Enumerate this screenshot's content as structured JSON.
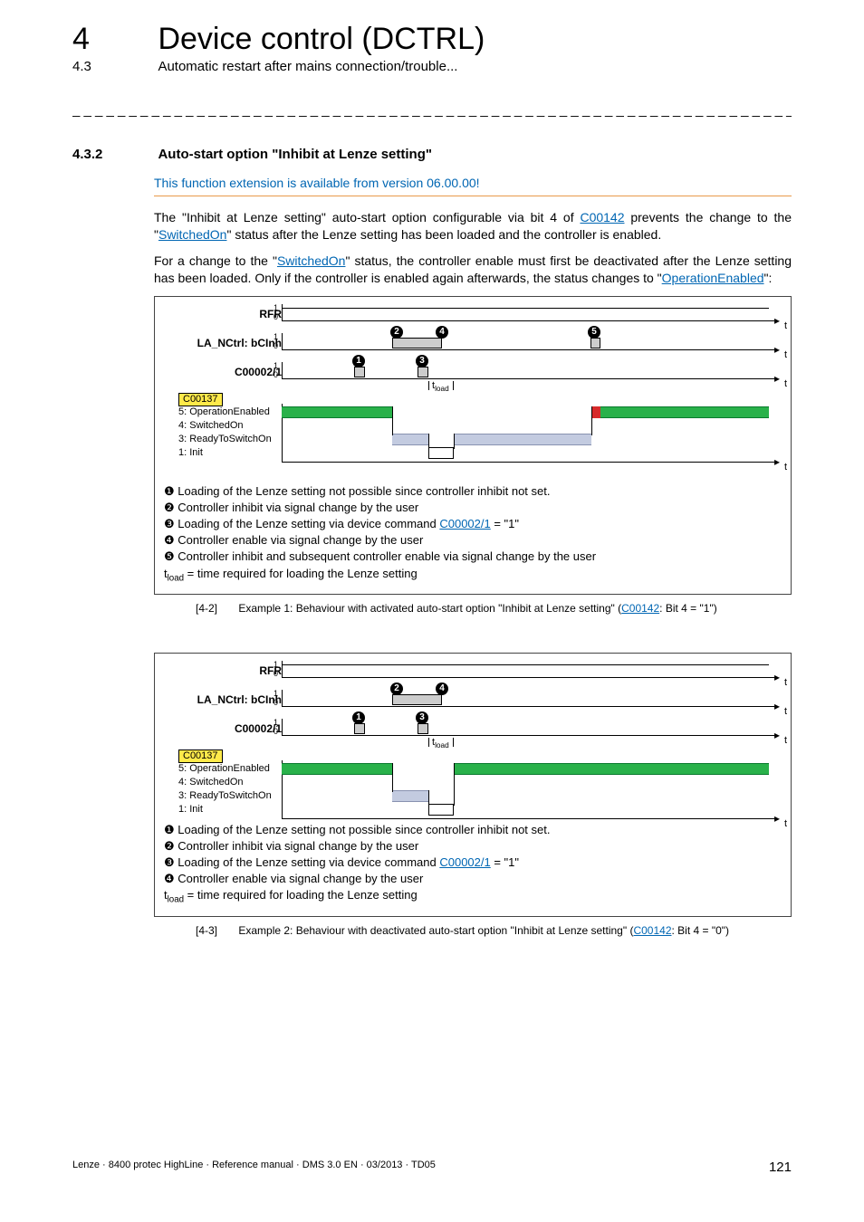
{
  "header": {
    "chapter_num": "4",
    "chapter_title": "Device control (DCTRL)",
    "sub_num": "4.3",
    "sub_title": "Automatic restart after mains connection/trouble...",
    "dash_rule": "_ _ _ _ _ _ _ _ _ _ _ _ _ _ _ _ _ _ _ _ _ _ _ _ _ _ _ _ _ _ _ _ _ _ _ _ _ _ _ _ _ _ _ _ _ _ _ _ _ _ _ _ _ _ _ _ _ _ _ _ _ _ _ _"
  },
  "section": {
    "num": "4.3.2",
    "title": "Auto-start option \"Inhibit at Lenze setting\"",
    "note": "This function extension is available from version 06.00.00!",
    "p1_a": "The  \"Inhibit at Lenze setting\" auto-start option configurable via bit 4 of ",
    "p1_link1": "C00142",
    "p1_b": " prevents the change to the \"",
    "p1_link2": "SwitchedOn",
    "p1_c": "\" status after the Lenze setting has been loaded and the controller is enabled.",
    "p2_a": "For a change to the \"",
    "p2_link1": "SwitchedOn",
    "p2_b": "\" status, the controller enable must first be deactivated after the Lenze setting has been loaded. Only if the controller is enabled again afterwards, the status changes to \"",
    "p2_link2": "OperationEnabled",
    "p2_c": "\":"
  },
  "fig1": {
    "labels": {
      "rfr": "RFR",
      "la": "LA_NCtrl: bCInh",
      "cmd": "C00002/1",
      "tload": "t",
      "tload_sub": "load",
      "pill": "C00137",
      "s5": "5: OperationEnabled",
      "s4": "4: SwitchedOn",
      "s3": "3: ReadyToSwitchOn",
      "s1": "1: Init",
      "t": "t"
    },
    "legend": {
      "l1": " Loading of the Lenze setting not possible since controller inhibit not set.",
      "l2": " Controller inhibit via signal change by the user",
      "l3_a": " Loading of the Lenze setting via device command ",
      "l3_link": "C00002/1",
      "l3_b": " = \"1\"",
      "l4": " Controller enable via signal change by the user",
      "l5": " Controller inhibit and subsequent controller enable via signal change by the user",
      "lt_a": "t",
      "lt_sub": "load",
      "lt_b": " = time required for loading the Lenze setting"
    },
    "caption_tag": "[4-2]",
    "caption_a": "Example 1: Behaviour with activated auto-start option \"Inhibit at Lenze setting\" (",
    "caption_link": "C00142",
    "caption_b": ": Bit 4 = \"1\")"
  },
  "fig2": {
    "labels": {
      "rfr": "RFR",
      "la": "LA_NCtrl: bCInh",
      "cmd": "C00002/1",
      "tload": "t",
      "tload_sub": "load",
      "pill": "C00137",
      "s5": "5: OperationEnabled",
      "s4": "4: SwitchedOn",
      "s3": "3: ReadyToSwitchOn",
      "s1": "1: Init",
      "t": "t"
    },
    "legend": {
      "l1": " Loading of the Lenze setting not possible since controller inhibit not set.",
      "l2": " Controller inhibit via signal change by the user",
      "l3_a": " Loading of the Lenze setting via device command ",
      "l3_link": "C00002/1",
      "l3_b": " = \"1\"",
      "l4": " Controller enable via signal change by the user",
      "lt_a": "t",
      "lt_sub": "load",
      "lt_b": " = time required for loading the Lenze setting"
    },
    "caption_tag": "[4-3]",
    "caption_a": "Example 2: Behaviour with deactivated auto-start option \"Inhibit at Lenze setting\" (",
    "caption_link": "C00142",
    "caption_b": ": Bit 4 = \"0\")"
  },
  "chart_data": [
    {
      "id": "fig1",
      "type": "timing-diagram",
      "signals": [
        {
          "name": "RFR",
          "ylim": [
            0,
            1
          ],
          "segments": [
            [
              0,
              1
            ],
            [
              1,
              1
            ]
          ]
        },
        {
          "name": "LA_NCtrl: bCInh",
          "ylim": [
            0,
            1
          ],
          "segments": [
            [
              0,
              0
            ],
            [
              0.22,
              1
            ],
            [
              0.32,
              0
            ],
            [
              0.68,
              1
            ],
            [
              0.7,
              0
            ],
            [
              1,
              0
            ]
          ]
        },
        {
          "name": "C00002/1",
          "ylim": [
            0,
            1
          ],
          "segments": [
            [
              0,
              0
            ],
            [
              0.15,
              1
            ],
            [
              0.17,
              0
            ],
            [
              0.27,
              1
            ],
            [
              0.29,
              0
            ],
            [
              1,
              0
            ]
          ]
        },
        {
          "name": "C00137",
          "states": [
            "1: Init",
            "3: ReadyToSwitchOn",
            "4: SwitchedOn",
            "5: OperationEnabled"
          ],
          "segments": [
            [
              0,
              "5"
            ],
            [
              0.22,
              "3"
            ],
            [
              0.29,
              "1"
            ],
            [
              0.33,
              "3"
            ],
            [
              0.68,
              "5"
            ],
            [
              1,
              "5"
            ]
          ]
        }
      ],
      "callouts": {
        "1": 0.15,
        "2": 0.22,
        "3": 0.27,
        "4": 0.32,
        "5": 0.68
      },
      "tload_span": [
        0.29,
        0.33
      ],
      "xlabel": "t"
    },
    {
      "id": "fig2",
      "type": "timing-diagram",
      "signals": [
        {
          "name": "RFR",
          "ylim": [
            0,
            1
          ],
          "segments": [
            [
              0,
              1
            ],
            [
              1,
              1
            ]
          ]
        },
        {
          "name": "LA_NCtrl: bCInh",
          "ylim": [
            0,
            1
          ],
          "segments": [
            [
              0,
              0
            ],
            [
              0.22,
              1
            ],
            [
              0.32,
              0
            ],
            [
              1,
              0
            ]
          ]
        },
        {
          "name": "C00002/1",
          "ylim": [
            0,
            1
          ],
          "segments": [
            [
              0,
              0
            ],
            [
              0.15,
              1
            ],
            [
              0.17,
              0
            ],
            [
              0.27,
              1
            ],
            [
              0.29,
              0
            ],
            [
              1,
              0
            ]
          ]
        },
        {
          "name": "C00137",
          "states": [
            "1: Init",
            "3: ReadyToSwitchOn",
            "4: SwitchedOn",
            "5: OperationEnabled"
          ],
          "segments": [
            [
              0,
              "5"
            ],
            [
              0.22,
              "3"
            ],
            [
              0.29,
              "1"
            ],
            [
              0.33,
              "5"
            ],
            [
              1,
              "5"
            ]
          ]
        }
      ],
      "callouts": {
        "1": 0.15,
        "2": 0.22,
        "3": 0.27,
        "4": 0.32
      },
      "tload_span": [
        0.29,
        0.33
      ],
      "xlabel": "t"
    }
  ],
  "footer": {
    "text": "Lenze · 8400 protec HighLine · Reference manual · DMS 3.0 EN · 03/2013 · TD05",
    "page": "121"
  }
}
